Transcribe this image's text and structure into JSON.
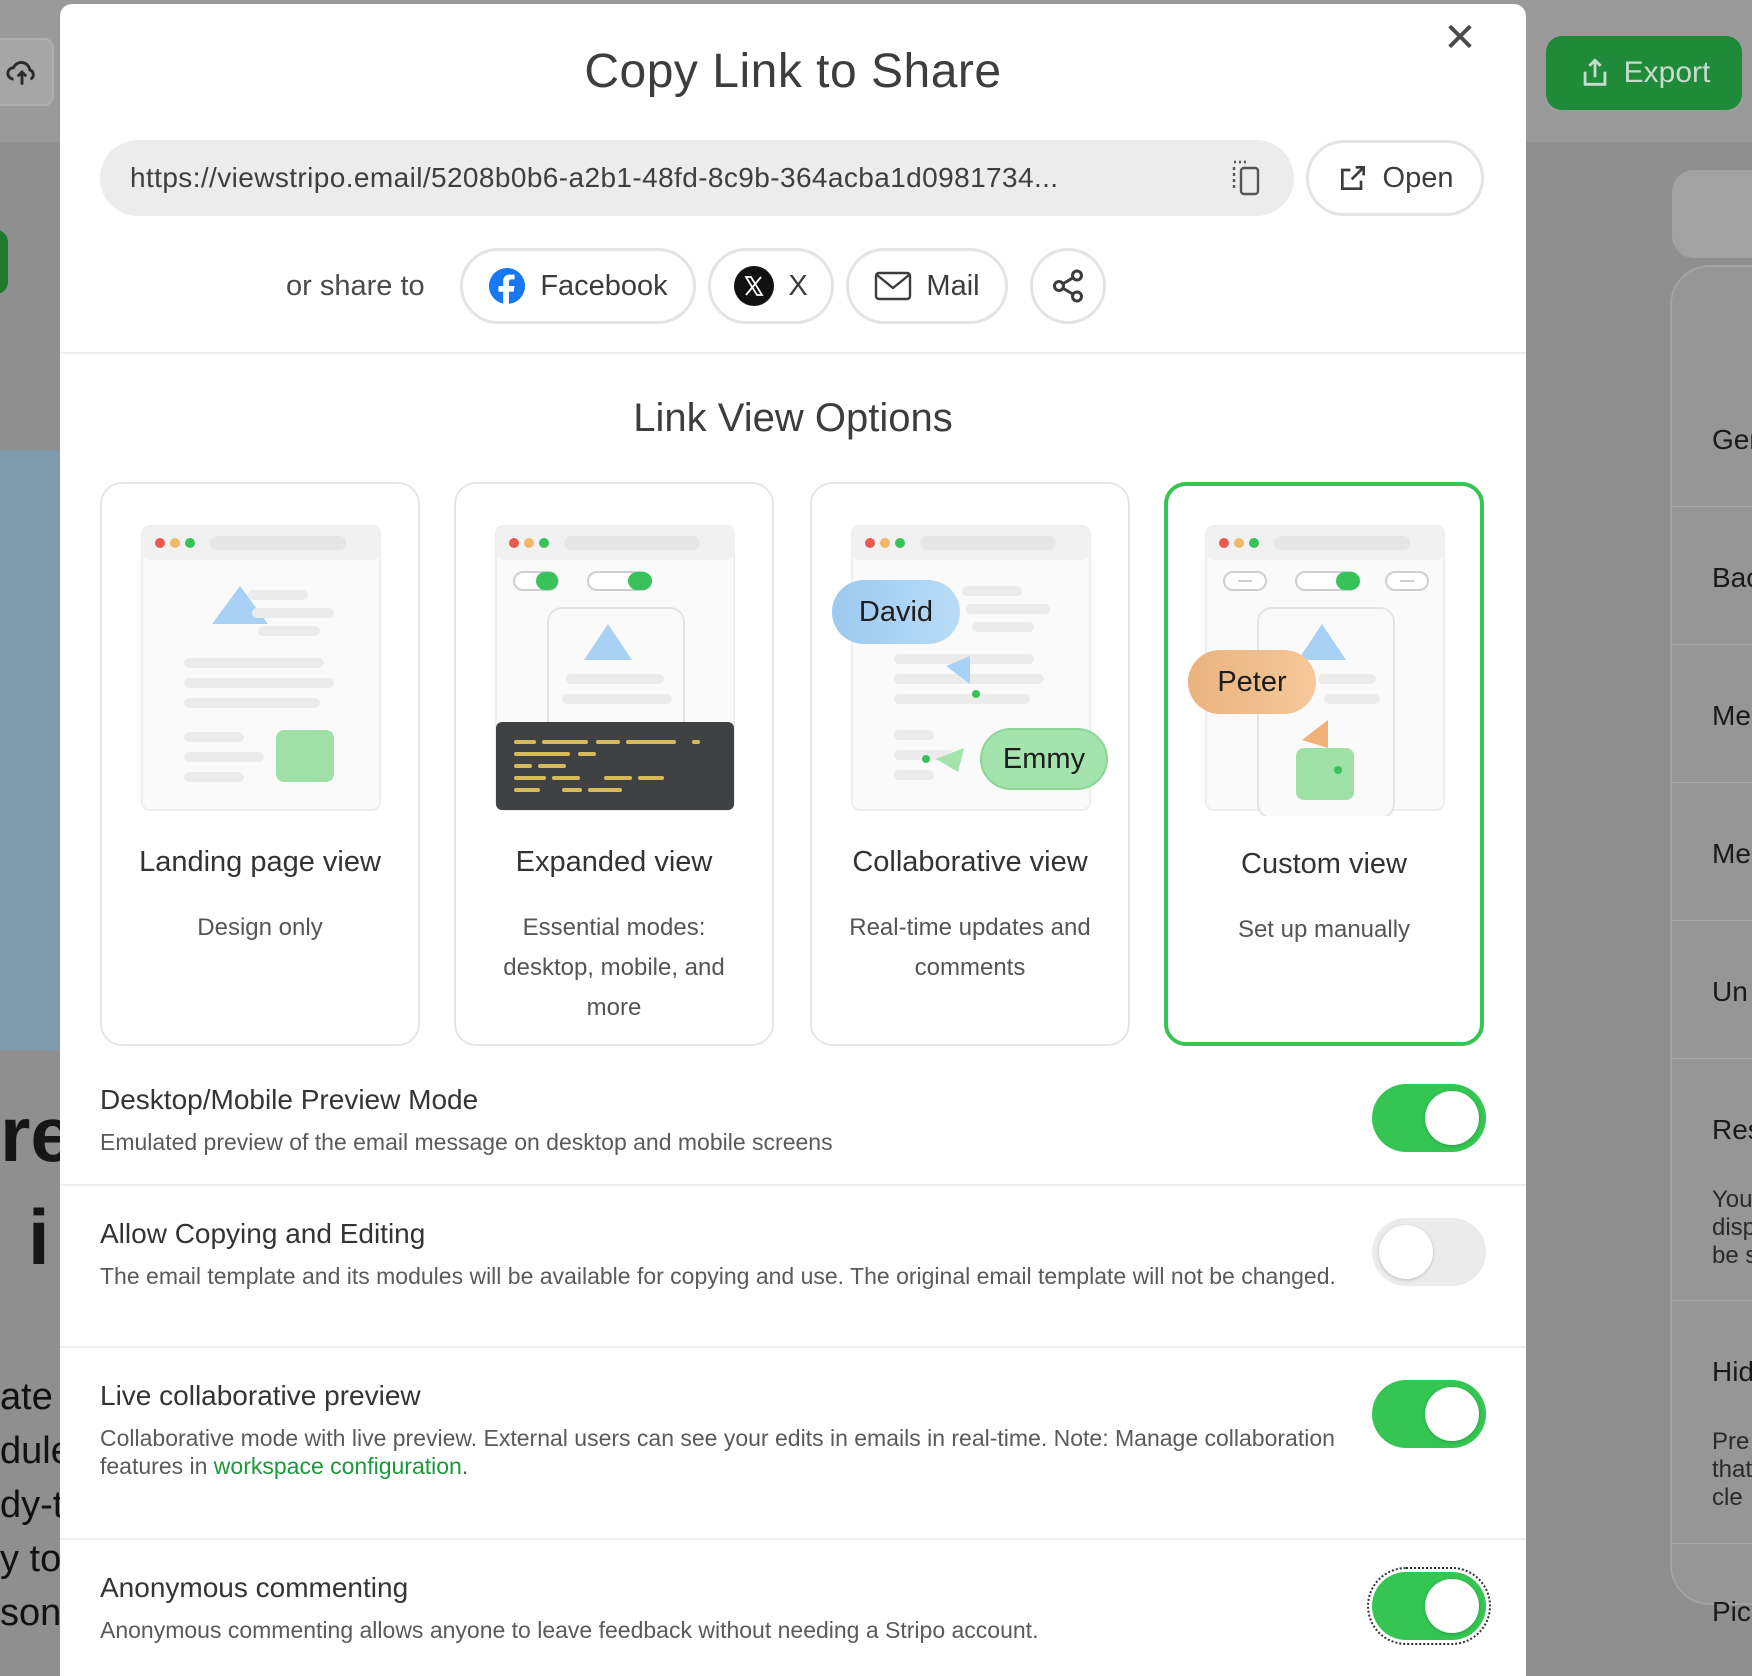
{
  "background": {
    "export_label": "Export",
    "left_letters_1": "re",
    "left_letters_2": "i",
    "left_text": "ate\ndule\ndy-t\ny to\nson",
    "right_items": [
      "Gen",
      "Bac",
      "Me",
      "Me",
      "Un",
      "Res",
      "Hid",
      "Pic"
    ],
    "right_small_1": "You\ndisp\nbe s",
    "right_small_2": "Pre\nthat\ncle"
  },
  "modal": {
    "title": "Copy Link to Share",
    "close_glyph": "✕",
    "link_url": "https://viewstripo.email/5208b0b6-a2b1-48fd-8c9b-364acba1d0981734...",
    "open_label": "Open",
    "share_label": "or share to",
    "share_buttons": {
      "facebook": "Facebook",
      "x": "X",
      "mail": "Mail"
    },
    "section_title": "Link View Options",
    "cards": [
      {
        "title": "Landing page view",
        "desc": "Design only",
        "selected": false
      },
      {
        "title": "Expanded view",
        "desc": "Essential modes: desktop, mobile, and more",
        "selected": false
      },
      {
        "title": "Collaborative view",
        "desc": "Real-time updates and comments",
        "selected": false,
        "names": [
          "David",
          "Emmy"
        ]
      },
      {
        "title": "Custom view",
        "desc": "Set up manually",
        "selected": true,
        "names": [
          "Peter"
        ]
      }
    ],
    "options": [
      {
        "title": "Desktop/Mobile Preview Mode",
        "desc": "Emulated preview of the email message on desktop and mobile screens",
        "enabled": true
      },
      {
        "title": "Allow Copying and Editing",
        "desc": "The email template and its modules will be available for copying and use. The original email template will not be changed.",
        "enabled": false
      },
      {
        "title": "Live collaborative preview",
        "desc_prefix": "Collaborative mode with live preview. External users can see your edits in emails in real-time. Note: Manage collaboration features in ",
        "desc_link": "workspace configuration",
        "desc_suffix": ".",
        "enabled": true
      },
      {
        "title": "Anonymous commenting",
        "desc": "Anonymous commenting allows anyone to leave feedback without needing a Stripo account.",
        "enabled": true
      }
    ]
  },
  "colors": {
    "accent": "#34c552",
    "link": "#1a9a3a",
    "export_bg": "#1f8a3a"
  }
}
